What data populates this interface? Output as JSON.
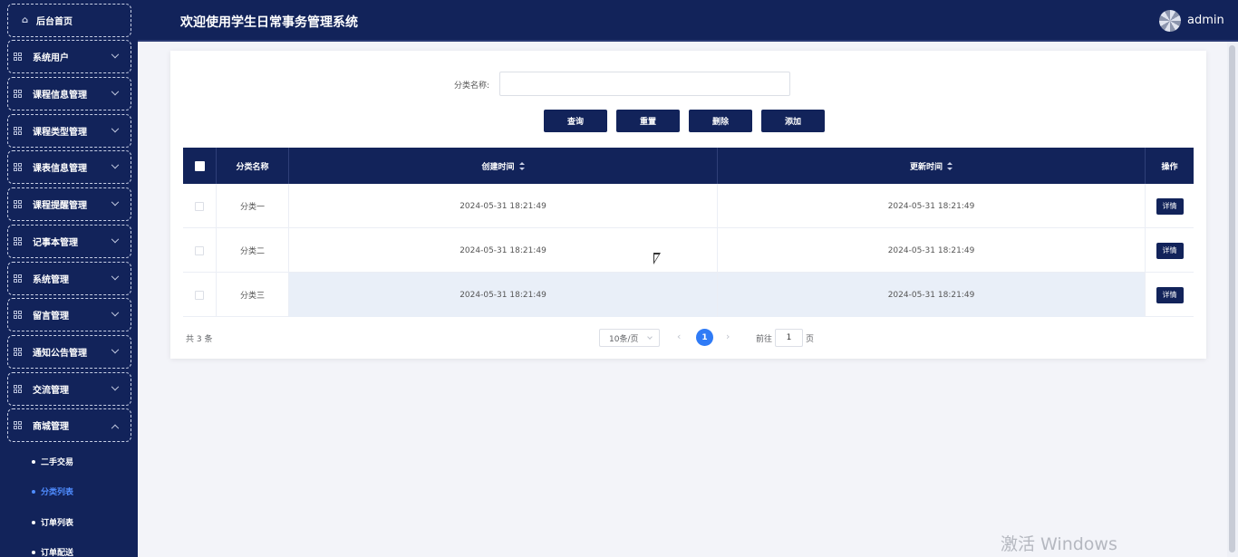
{
  "sidebar": {
    "home_label": "后台首页",
    "items": [
      {
        "label": "系统用户"
      },
      {
        "label": "课程信息管理"
      },
      {
        "label": "课程类型管理"
      },
      {
        "label": "课表信息管理"
      },
      {
        "label": "课程提醒管理"
      },
      {
        "label": "记事本管理"
      },
      {
        "label": "系统管理"
      },
      {
        "label": "留言管理"
      },
      {
        "label": "通知公告管理"
      },
      {
        "label": "交流管理"
      },
      {
        "label": "商城管理"
      }
    ],
    "sub_items": [
      {
        "label": "二手交易"
      },
      {
        "label": "分类列表",
        "active": true
      },
      {
        "label": "订单列表"
      },
      {
        "label": "订单配送"
      }
    ]
  },
  "header": {
    "title": "欢迎使用学生日常事务管理系统",
    "username": "admin"
  },
  "search": {
    "label": "分类名称:",
    "value": "",
    "placeholder": ""
  },
  "buttons": {
    "query": "查询",
    "reset": "重置",
    "delete": "删除",
    "add": "添加"
  },
  "table": {
    "headers": {
      "name": "分类名称",
      "created": "创建时间",
      "updated": "更新时间",
      "action": "操作"
    },
    "rows": [
      {
        "name": "分类一",
        "created": "2024-05-31 18:21:49",
        "updated": "2024-05-31 18:21:49",
        "action": "详情"
      },
      {
        "name": "分类二",
        "created": "2024-05-31 18:21:49",
        "updated": "2024-05-31 18:21:49",
        "action": "详情"
      },
      {
        "name": "分类三",
        "created": "2024-05-31 18:21:49",
        "updated": "2024-05-31 18:21:49",
        "action": "详情"
      }
    ]
  },
  "pagination": {
    "total": "共 3 条",
    "page_size": "10条/页",
    "current_page": "1",
    "prev": "‹",
    "next": "›",
    "goto_label": "前往",
    "goto_value": "1",
    "goto_suffix": "页"
  },
  "watermark": "激活 Windows",
  "colors": {
    "navy": "#12235a",
    "accent": "#2f7bf6",
    "active_sub": "#4f8cff",
    "row_highlight": "#e9eff8"
  },
  "icons": {
    "home": "home-icon",
    "menu": "grid-icon",
    "expand": "chevron-down-icon",
    "collapse": "chevron-up-icon",
    "sort": "sort-icon"
  }
}
